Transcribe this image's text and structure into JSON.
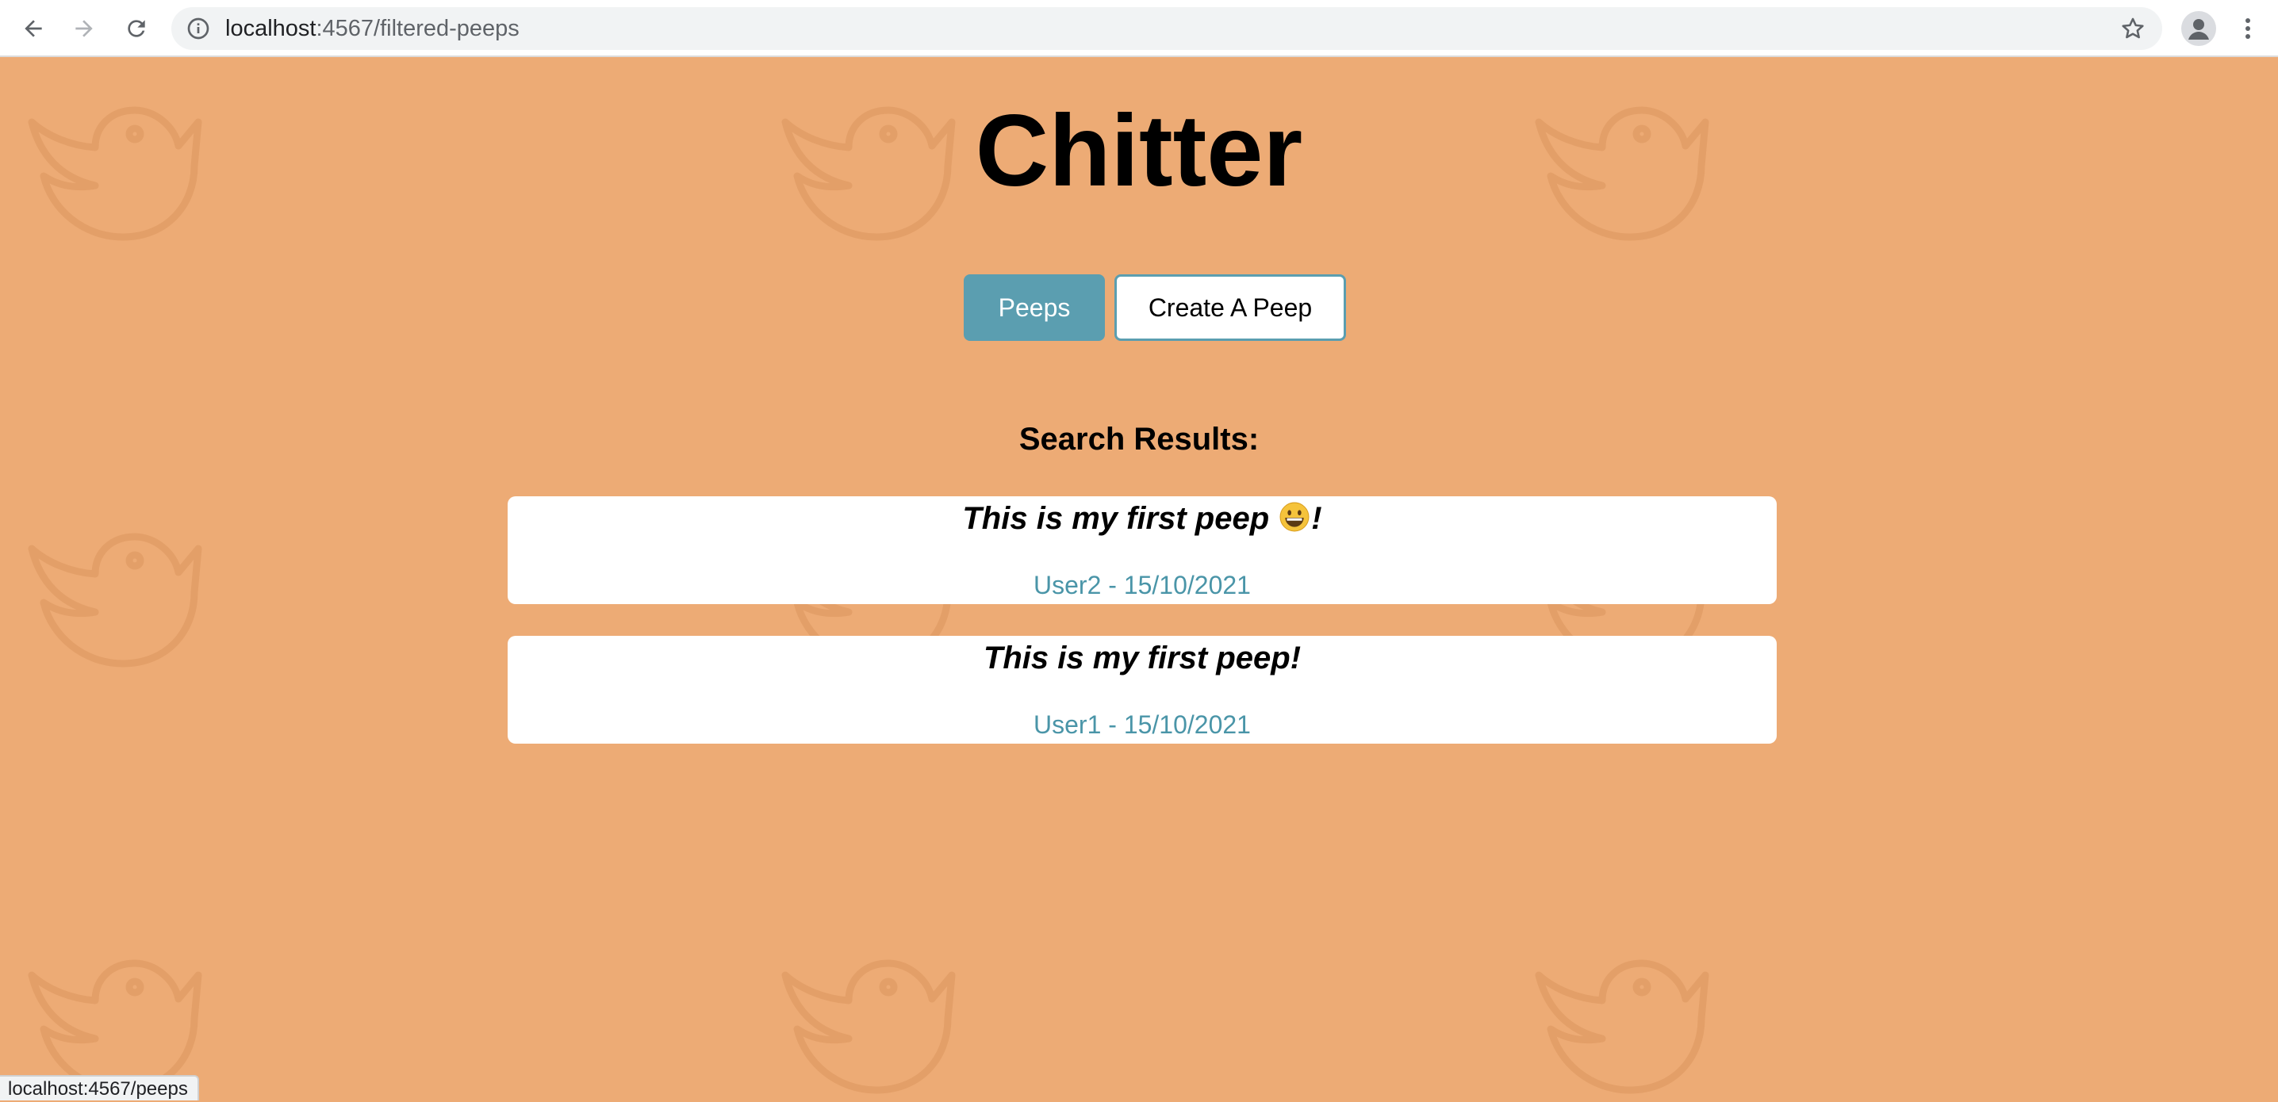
{
  "browser": {
    "url_host": "localhost",
    "url_path": ":4567/filtered-peeps",
    "status_url": "localhost:4567/peeps"
  },
  "site": {
    "title": "Chitter"
  },
  "nav": {
    "peeps_label": "Peeps",
    "create_label": "Create A Peep"
  },
  "results": {
    "heading": "Search Results:",
    "peeps": [
      {
        "text_before": "This is my first peep",
        "emoji": "grinning-face",
        "text_after": "!",
        "meta": "User2 - 15/10/2021"
      },
      {
        "text_before": "This is my first peep!",
        "emoji": "",
        "text_after": "",
        "meta": "User1 - 15/10/2021"
      }
    ]
  },
  "colors": {
    "page_background": "#edab75",
    "accent": "#5b9eb0",
    "meta_text": "#4a95a8",
    "bird_watermark": "#e39f68"
  },
  "icons": {
    "back": "arrow-left-icon",
    "forward": "arrow-right-icon",
    "reload": "reload-icon",
    "site_info": "info-icon",
    "bookmark": "star-icon",
    "profile": "profile-icon",
    "menu": "kebab-menu-icon",
    "background": "twitter-bird-icon"
  }
}
